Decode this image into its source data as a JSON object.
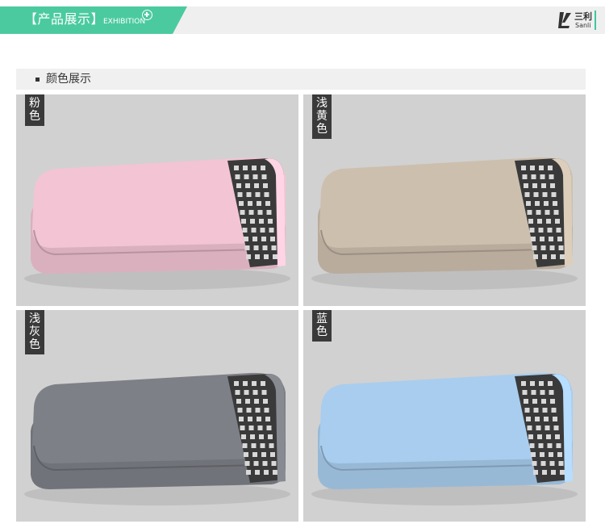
{
  "header": {
    "title": "【产品展示】",
    "subtitle": "EXHIBITION",
    "accent_color": "#4bcaa0",
    "logo": {
      "cn": "三利",
      "en": "Sanli"
    }
  },
  "section": {
    "label": "颜色展示"
  },
  "products": [
    {
      "label": "粉色",
      "chars": [
        "粉",
        "色"
      ],
      "color": "#f2c4d4"
    },
    {
      "label": "浅黄色",
      "chars": [
        "浅",
        "黄",
        "色"
      ],
      "color": "#cdbfae"
    },
    {
      "label": "浅灰色",
      "chars": [
        "浅",
        "灰",
        "色"
      ],
      "color": "#7e8087"
    },
    {
      "label": "蓝色",
      "chars": [
        "蓝",
        "色"
      ],
      "color": "#a9cdee"
    }
  ],
  "icons": [
    "plus-circle-icon",
    "sanli-logo-icon",
    "bullet-icon"
  ]
}
